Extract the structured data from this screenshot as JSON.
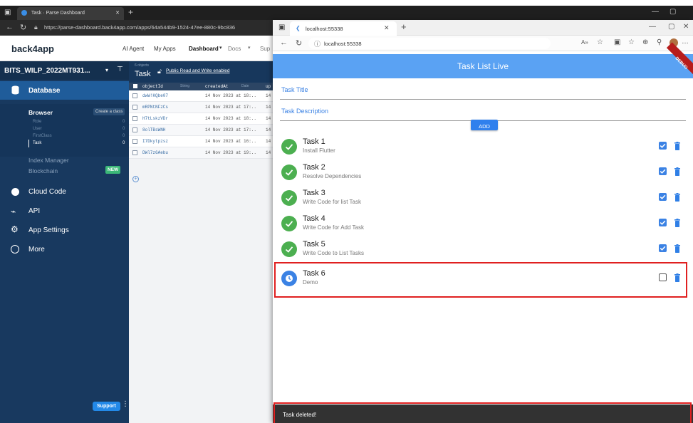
{
  "back_browser": {
    "tab_title": "Task · Parse Dashboard",
    "url": "https://parse-dashboard.back4app.com/apps/64a544b9-1524-47ee-880c-9bc836",
    "brand": "back4app",
    "nav": [
      "AI Agent",
      "My Apps",
      "Dashboard",
      "Docs",
      "Sup"
    ],
    "app_name": "BITS_WILP_2022MT931...",
    "sidebar": {
      "database": "Database",
      "browser": "Browser",
      "create_class": "Create a class",
      "classes": [
        {
          "name": "Role",
          "count": "0"
        },
        {
          "name": "User",
          "count": "0"
        },
        {
          "name": "FirstClass",
          "count": "0"
        },
        {
          "name": "Task",
          "count": "0"
        }
      ],
      "index_manager": "Index Manager",
      "blockchain": "Blockchain",
      "new_badge": "NEW",
      "cloud_code": "Cloud Code",
      "api": "API",
      "app_settings": "App Settings",
      "more": "More",
      "support": "Support"
    },
    "class_header": {
      "objects": "6 objects",
      "class_name": "Task",
      "permission": "Public Read and Write enabled"
    },
    "table": {
      "headers": [
        "objectId",
        "createdAt",
        "up"
      ],
      "header_types": [
        "String",
        "Date"
      ],
      "rows": [
        [
          "dwW!KQbe07",
          "14 Nov 2023 at 18:..",
          "14"
        ],
        [
          "mRPNtNFzCs",
          "14 Nov 2023 at 17:..",
          "14"
        ],
        [
          "H7tLskzVDr",
          "14 Nov 2023 at 18:..",
          "14"
        ],
        [
          "8olTBsWNH",
          "14 Nov 2023 at 17:..",
          "14"
        ],
        [
          "I7Dkytpzsz",
          "14 Nov 2023 at 16:..",
          "14"
        ],
        [
          "DWl7z6Aebu",
          "14 Nov 2023 at 19:..",
          "14"
        ]
      ]
    }
  },
  "front_browser": {
    "tab_title": "localhost:55338",
    "url": "localhost:55338",
    "app_title": "Task List Live",
    "debug_banner": "DEBUG",
    "title_placeholder": "Task Title",
    "desc_placeholder": "Task Description",
    "add_label": "ADD",
    "tasks": [
      {
        "title": "Task 1",
        "desc": "Install Flutter",
        "done": true
      },
      {
        "title": "Task 2",
        "desc": "Resolve Dependencies",
        "done": true
      },
      {
        "title": "Task 3",
        "desc": "Write Code for list Task",
        "done": true
      },
      {
        "title": "Task 4",
        "desc": "Write Code for Add Task",
        "done": true
      },
      {
        "title": "Task 5",
        "desc": "Write Code to List Tasks",
        "done": true
      },
      {
        "title": "Task 6",
        "desc": "Demo",
        "done": false
      }
    ],
    "snackbar": "Task deleted!"
  },
  "colors": {
    "app_bar": "#5aa2f3",
    "done": "#4caf50",
    "pending": "#3b82e4",
    "highlight": "#e02020",
    "sidebar": "#18395f"
  }
}
